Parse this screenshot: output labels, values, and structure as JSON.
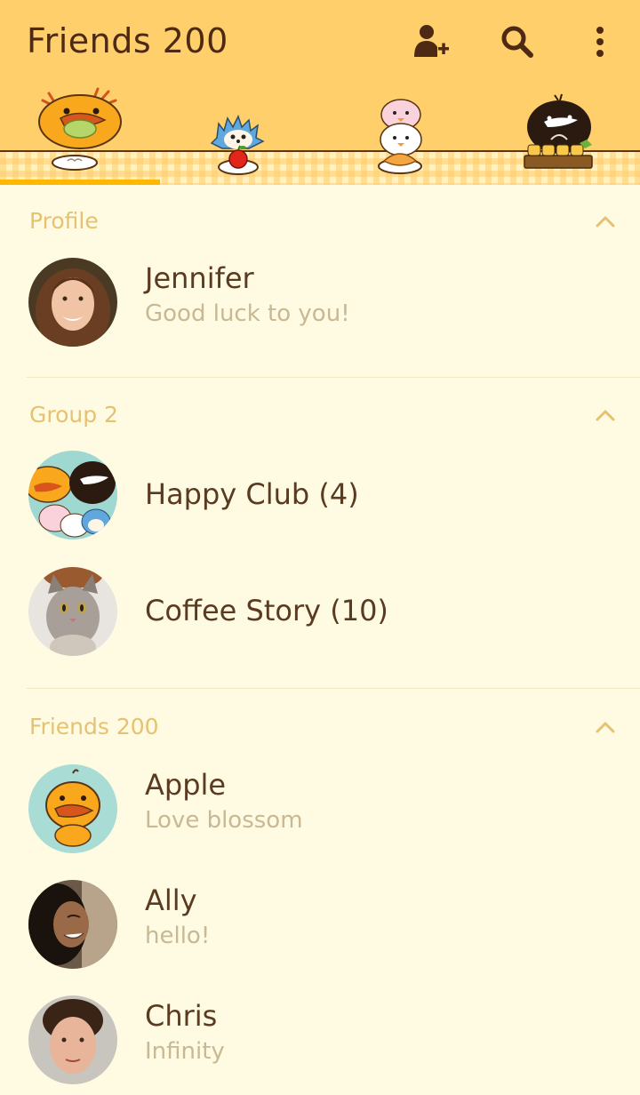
{
  "header": {
    "title": "Friends 200",
    "icons": [
      "add-friend-icon",
      "search-icon",
      "more-icon"
    ]
  },
  "tabs": [
    {
      "name": "duck-eating-salad",
      "active": true
    },
    {
      "name": "hedgehog-apple",
      "active": false
    },
    {
      "name": "chick-stack-taiyaki",
      "active": false
    },
    {
      "name": "black-bird-sushi",
      "active": false
    }
  ],
  "sections": {
    "profile": {
      "title": "Profile"
    },
    "groups": {
      "title": "Group 2"
    },
    "friends": {
      "title": "Friends 200"
    }
  },
  "profile": {
    "name": "Jennifer",
    "status": "Good luck to you!"
  },
  "groups": [
    {
      "name": "Happy Club (4)"
    },
    {
      "name": "Coffee Story (10)"
    }
  ],
  "friends": [
    {
      "name": "Apple",
      "status": "Love blossom"
    },
    {
      "name": "Ally",
      "status": "hello!"
    },
    {
      "name": "Chris",
      "status": "Infinity"
    }
  ],
  "colors": {
    "header_bg": "#ffcf6b",
    "page_bg": "#fffbe3",
    "title_text": "#4e2a14",
    "section_text": "#e4c271",
    "name_text": "#5a3a20",
    "status_text": "#c8b894",
    "tab_indicator": "#ffb800"
  }
}
